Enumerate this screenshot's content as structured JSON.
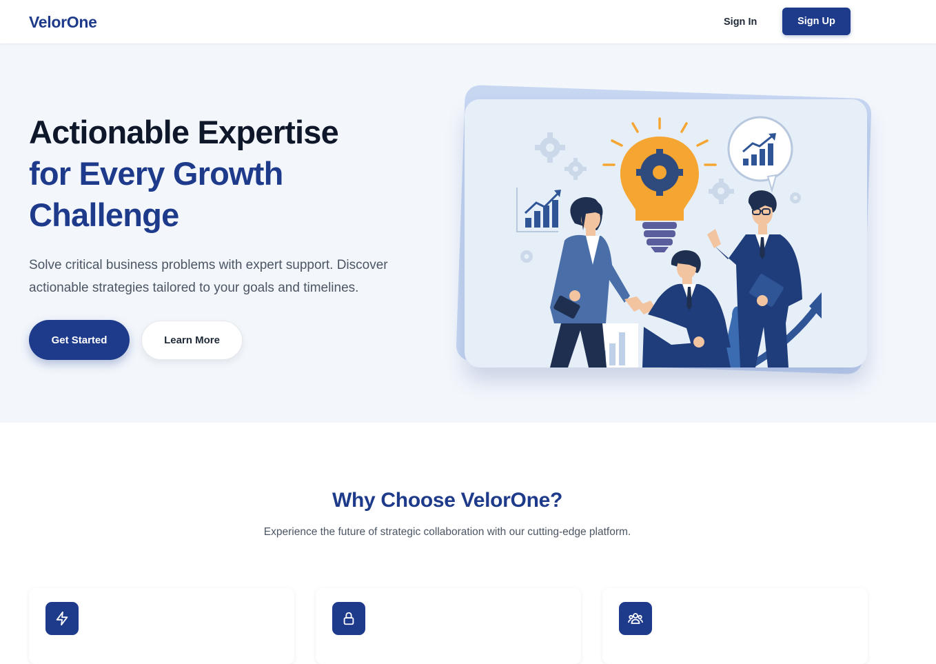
{
  "header": {
    "logo": "VelorOne",
    "signin_label": "Sign In",
    "signup_label": "Sign Up"
  },
  "hero": {
    "title_line1": "Actionable Expertise",
    "title_line2": "for Every Growth",
    "title_line3": "Challenge",
    "subtitle": "Solve critical business problems with expert support. Discover actionable strategies tailored to your goals and timelines.",
    "primary_button": "Get Started",
    "secondary_button": "Learn More"
  },
  "why": {
    "title": "Why Choose VelorOne?",
    "subtitle": "Experience the future of strategic collaboration with our cutting-edge platform."
  },
  "features": [
    {
      "icon": "lightning-icon"
    },
    {
      "icon": "lock-icon"
    },
    {
      "icon": "users-icon"
    }
  ],
  "colors": {
    "brand": "#1e3a8a",
    "hero_bg": "#f3f7fc",
    "accent": "#f5a531"
  }
}
